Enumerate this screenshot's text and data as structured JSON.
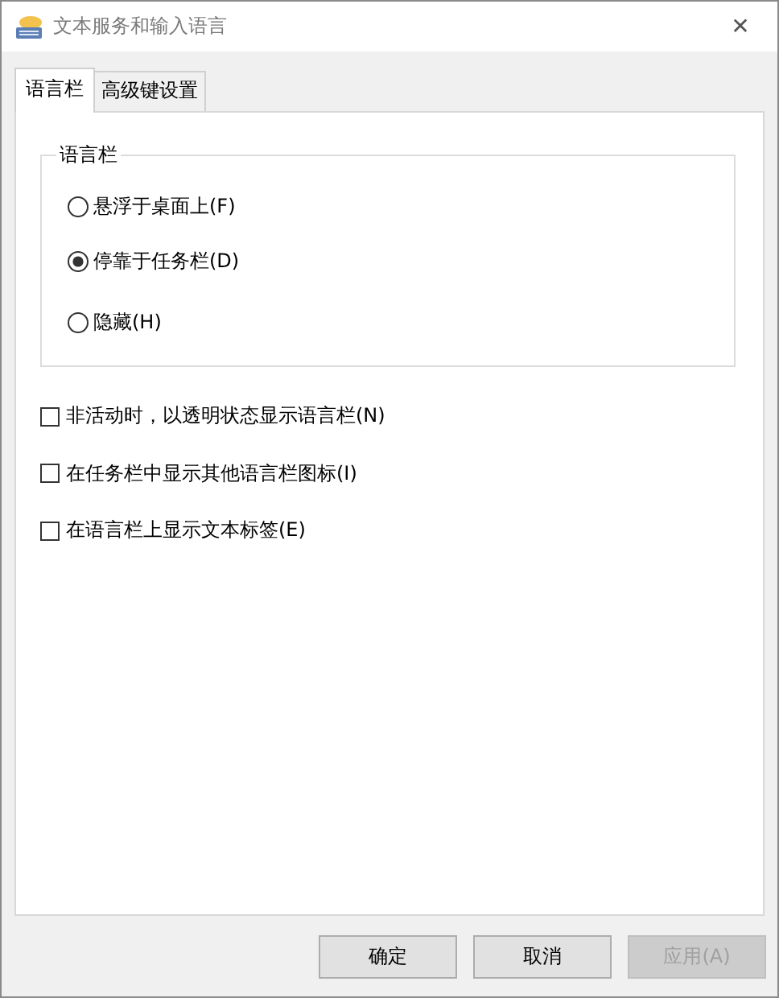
{
  "window": {
    "title": "文本服务和输入语言",
    "close": "✕"
  },
  "tabs": [
    {
      "label": "语言栏",
      "selected": true
    },
    {
      "label": "高级键设置",
      "selected": false
    }
  ],
  "group": {
    "title": "语言栏",
    "options": [
      {
        "label": "悬浮于桌面上(F)",
        "selected": false
      },
      {
        "label": "停靠于任务栏(D)",
        "selected": true
      },
      {
        "label": "隐藏(H)",
        "selected": false
      }
    ]
  },
  "checkboxes": [
    {
      "label": "非活动时，以透明状态显示语言栏(N)",
      "checked": false
    },
    {
      "label": "在任务栏中显示其他语言栏图标(I)",
      "checked": false
    },
    {
      "label": "在语言栏上显示文本标签(E)",
      "checked": false
    }
  ],
  "buttons": [
    {
      "label": "确定",
      "disabled": false
    },
    {
      "label": "取消",
      "disabled": false
    },
    {
      "label": "应用(A)",
      "disabled": true
    }
  ]
}
